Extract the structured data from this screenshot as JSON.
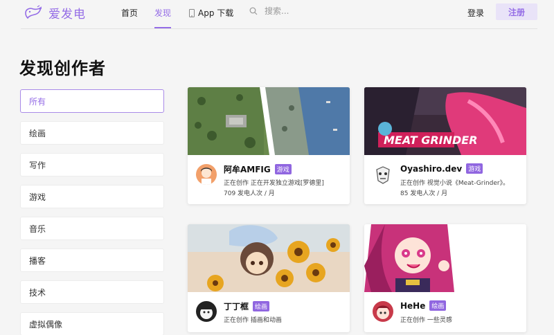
{
  "app": {
    "name": "爱发电",
    "brand_color": "#946ce6"
  },
  "nav": {
    "home": "首页",
    "discover": "发现",
    "app_download": "App 下载",
    "search_placeholder": "搜索...",
    "login": "登录",
    "register": "注册"
  },
  "page": {
    "title": "发现创作者"
  },
  "categories": [
    "所有",
    "绘画",
    "写作",
    "游戏",
    "音乐",
    "播客",
    "技术",
    "虚拟偶像"
  ],
  "active_category": "所有",
  "creators": [
    {
      "name": "阿牟AMFIG",
      "tag": "游戏",
      "desc": "正在创作 正在开发独立游戏[罗德里]",
      "stats": "709 发电人次 / 月",
      "image": "pixel-map-game-art"
    },
    {
      "name": "Oyashiro.dev",
      "tag": "游戏",
      "desc": "正在创作 视觉小说《Meat-Grinder》。",
      "stats": "85 发电人次 / 月",
      "image": "meat-grinder-key-art"
    },
    {
      "name": "丁丁框",
      "tag": "绘画",
      "desc": "正在创作 插画和动画",
      "stats": "",
      "image": "girl-with-sunflowers-illustration"
    },
    {
      "name": "HeHe",
      "tag": "绘画",
      "desc": "正在创作 一些灵感",
      "stats": "",
      "image": "pink-hair-anime-girl-illustration"
    }
  ]
}
